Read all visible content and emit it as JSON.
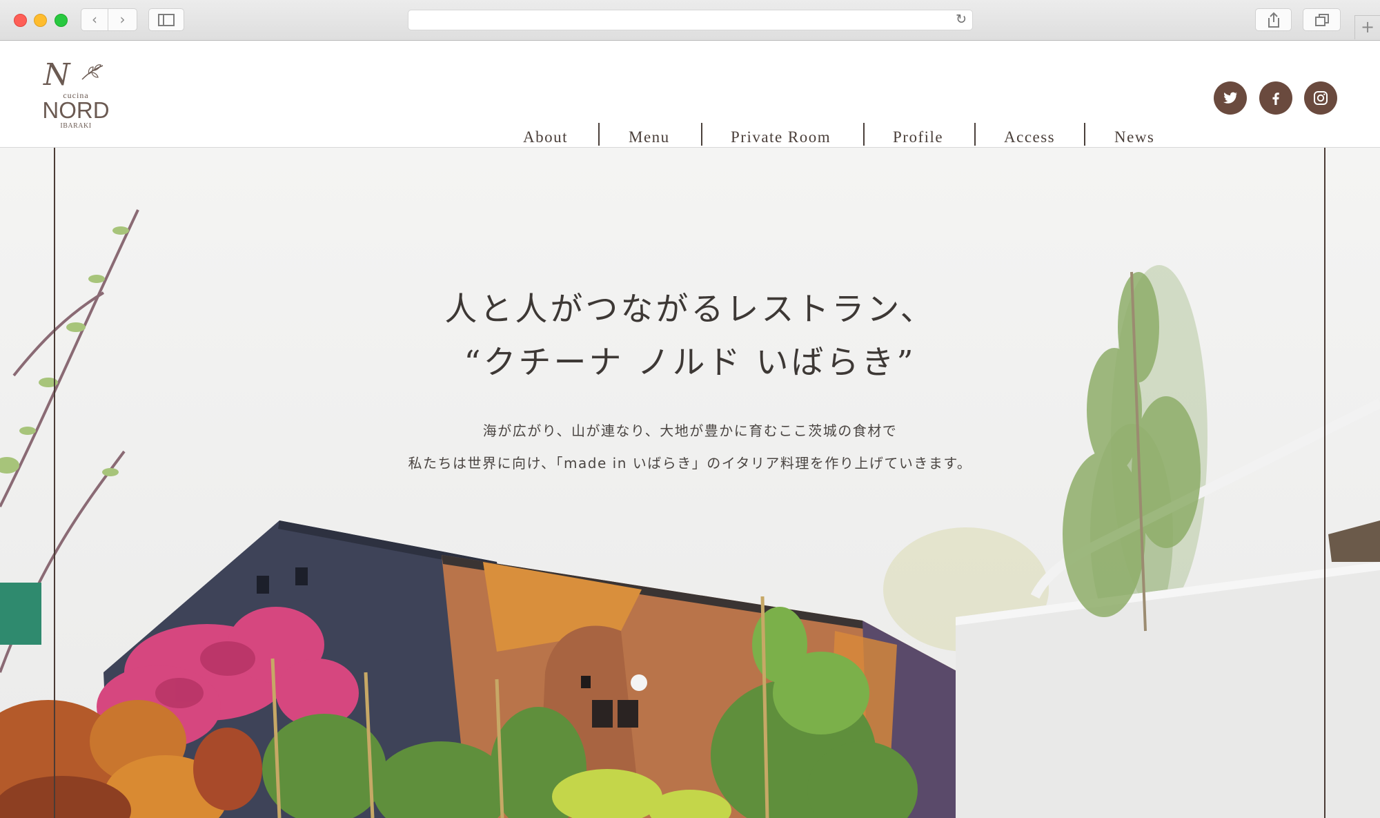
{
  "browser": {
    "address_text": "",
    "back_glyph": "‹",
    "forward_glyph": "›",
    "reload_glyph": "↻",
    "new_tab_glyph": "+"
  },
  "logo": {
    "script": "N",
    "cucina": "cucina",
    "name": "NORD",
    "location": "IBARAKI"
  },
  "nav": {
    "items": [
      {
        "label": "About"
      },
      {
        "label": "Menu"
      },
      {
        "label": "Private Room"
      },
      {
        "label": "Profile"
      },
      {
        "label": "Access"
      },
      {
        "label": "News"
      }
    ]
  },
  "social": [
    {
      "icon": "twitter-icon"
    },
    {
      "icon": "facebook-icon"
    },
    {
      "icon": "instagram-icon"
    }
  ],
  "hero": {
    "title_line1": "人と人がつながるレストラン、",
    "title_line2": "“クチーナ ノルド いばらき”",
    "sub_line1": "海が広がり、山が連なり、大地が豊かに育むここ茨城の食材で",
    "sub_line2": "私たちは世界に向け、「made in いばらき」のイタリア料理を作り上げていきます。"
  },
  "colors": {
    "brand_brown": "#6a4a3e",
    "text_dark": "#3d3835"
  }
}
